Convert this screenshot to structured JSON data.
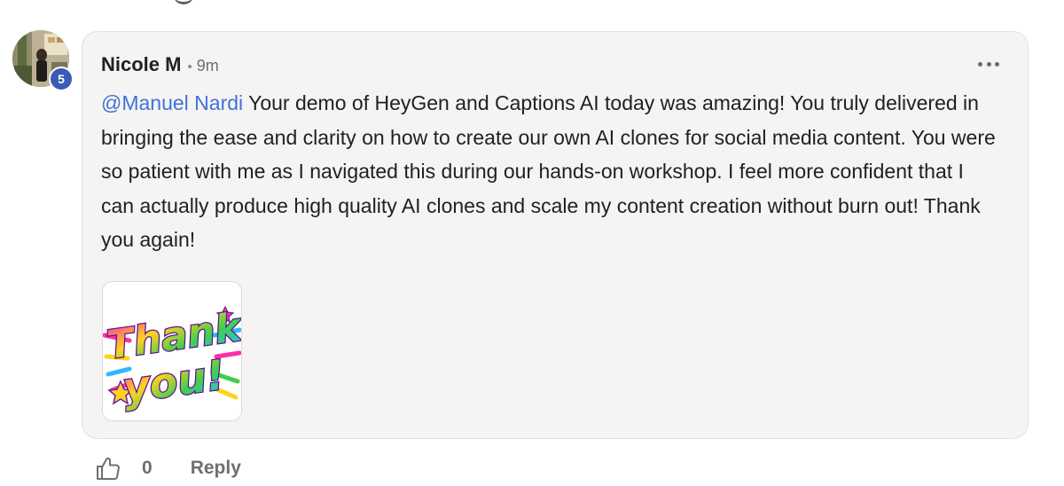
{
  "comment": {
    "author": {
      "name": "Nicole M",
      "level": "5",
      "avatar": "profile-photo"
    },
    "separator": "•",
    "timestamp": "9m",
    "more_icon": "more-horizontal-icon",
    "mention": "@Manuel Nardi",
    "body": " Your demo of HeyGen and Captions AI today was amazing! You truly delivered in bringing the ease and clarity on how to create our own AI clones for social media content. You were so patient with me as I navigated this during our hands-on workshop. I feel more confident that I can actually produce high quality AI clones and scale my content creation without burn out! Thank you again!",
    "attachment": {
      "type": "image",
      "lettering": [
        "Thank",
        "you!"
      ]
    },
    "actions": {
      "like_icon": "thumbs-up-icon",
      "like_count": "0",
      "reply_label": "Reply"
    }
  },
  "colors": {
    "mention": "#3f72d8",
    "badge": "#3c5bb5",
    "bubble_bg": "#f5f4f2"
  }
}
